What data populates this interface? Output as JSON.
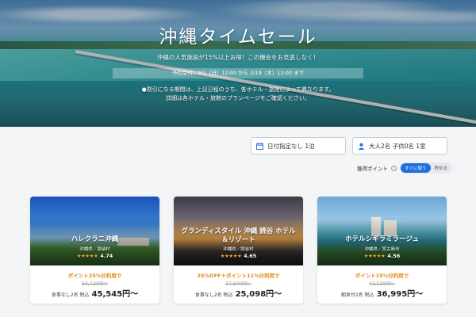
{
  "hero": {
    "title": "沖縄タイムセール",
    "subtitle": "沖縄の人気施設が15%以上お得！この機会をお見逃しなく！",
    "period": "予約受付：2/1（日）12:00 から 2/19（木）12:00 まで",
    "note_line1": "●割引になる期間は、上記日程のうち、各ホテル・旅館によって異なります。",
    "note_line2": "詳細は各ホテル・旅館のプランページをご確認ください。"
  },
  "search": {
    "date_label": "日付指定なし 1泊",
    "guest_label": "大人2名 子供0名 1室"
  },
  "points": {
    "label": "獲得ポイント",
    "toggle_on": "すぐに使う",
    "toggle_off": "貯める"
  },
  "cards": [
    {
      "name": "ハレクラニ沖縄",
      "location": "沖縄県／恩納村",
      "stars": "★★★★★",
      "rating": "4.74",
      "promo": "ポイント25%分利用で",
      "original_price": "60,720円〜",
      "price_label": "食事なし2名 税込",
      "price": "45,545円〜"
    },
    {
      "name": "グランディスタイル 沖縄 読谷 ホテル＆リゾート",
      "location": "沖縄県／読谷村",
      "stars": "★★★★★",
      "rating": "4.65",
      "promo": "25%OFF＋ポイント11%分利用で",
      "original_price": "37,600円〜",
      "price_label": "食事なし2名 税込",
      "price": "25,098円〜"
    },
    {
      "name": "ホテルシギラミラージュ",
      "location": "沖縄県／宮古島市",
      "stars": "★★★★★",
      "rating": "4.56",
      "promo": "ポイント15%分利用で",
      "original_price": "43,520円〜",
      "price_label": "朝食付2名 税込",
      "price": "36,995円〜"
    }
  ],
  "colors": {
    "accent_blue": "#1f6fde",
    "promo_orange": "#e0890f",
    "star_gold": "#f3a423"
  }
}
